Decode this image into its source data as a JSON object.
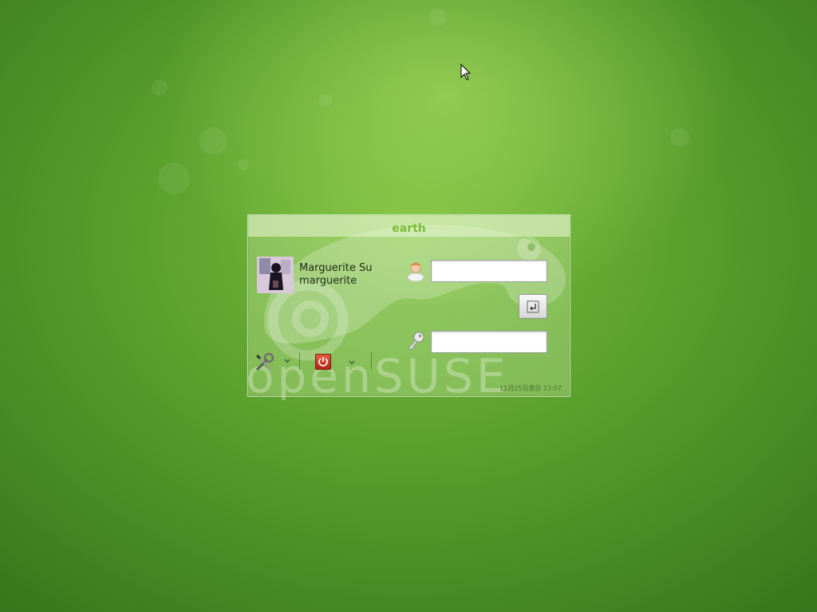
{
  "dialog": {
    "host_name": "earth"
  },
  "user": {
    "full_name": "Marguerite Su",
    "login_name": "marguerite"
  },
  "fields": {
    "username_value": "",
    "password_value": ""
  },
  "watermark": {
    "brand_text": "openSUSE"
  },
  "status": {
    "clock_text": "11月25日周日 23:57"
  },
  "icons": {
    "cursor": "mouse-pointer-icon",
    "user": "user-icon",
    "key": "key-icon",
    "login": "enter-arrow-icon",
    "tools": "wrench-screwdriver-icon",
    "power": "power-icon",
    "chevron": "chevron-down-icon"
  },
  "colors": {
    "title": "#7bbd3a",
    "power_button": "#d23c2a",
    "background": "#5fa52e"
  }
}
